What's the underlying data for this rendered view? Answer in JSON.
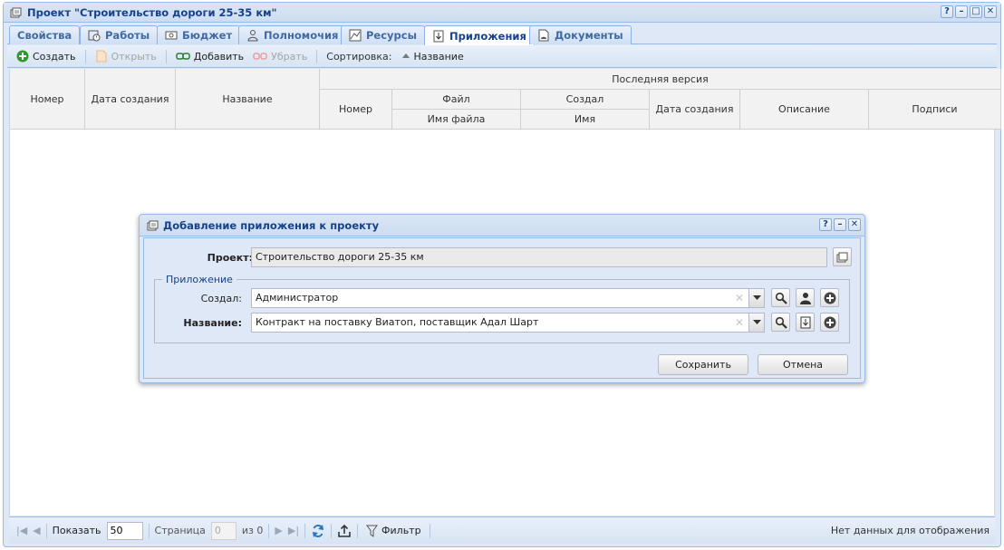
{
  "window": {
    "title": "Проект \"Строительство дороги 25-35 км\"",
    "tools": [
      "?",
      "–",
      "□",
      "✕"
    ]
  },
  "tabs": [
    {
      "label": "Свойства",
      "icon": "none"
    },
    {
      "label": "Работы",
      "icon": "tasks-icon"
    },
    {
      "label": "Бюджет",
      "icon": "money-icon"
    },
    {
      "label": "Полномочия",
      "icon": "user-permissions-icon"
    },
    {
      "label": "Ресурсы",
      "icon": "chart-icon"
    },
    {
      "label": "Приложения",
      "icon": "attachment-icon",
      "active": true
    },
    {
      "label": "Документы",
      "icon": "documents-icon"
    }
  ],
  "toolbar": {
    "create": "Создать",
    "open": "Открыть",
    "add": "Добавить",
    "remove": "Убрать",
    "sort_label": "Сортировка:",
    "sort_field": "Название"
  },
  "grid": {
    "col_number": "Номер",
    "col_created": "Дата создания",
    "col_name": "Название",
    "group_last_version": "Последняя версия",
    "sub_number": "Номер",
    "group_file": "Файл",
    "sub_filename": "Имя файла",
    "group_creator": "Создал",
    "sub_creator_name": "Имя",
    "sub_created": "Дата создания",
    "sub_description": "Описание",
    "sub_signatures": "Подписи"
  },
  "pager": {
    "show_label": "Показать",
    "page_size": "50",
    "page_label": "Страница",
    "page_value": "0",
    "of_label": "из 0",
    "filter_label": "Фильтр",
    "status": "Нет данных для отображения"
  },
  "dialog": {
    "title": "Добавление приложения к проекту",
    "project_label": "Проект:",
    "project_value": "Строительство дороги 25-35 км",
    "group_legend": "Приложение",
    "creator_label": "Создал:",
    "creator_value": "Администратор",
    "name_label": "Название:",
    "name_value": "Контракт на поставку Виатоп, поставщик Адал Шарт",
    "save": "Сохранить",
    "cancel": "Отмена"
  },
  "colors": {
    "accent": "#15428b",
    "panel": "#dfe8f6",
    "border": "#99bbe8",
    "create_green": "#2e9b2e"
  }
}
